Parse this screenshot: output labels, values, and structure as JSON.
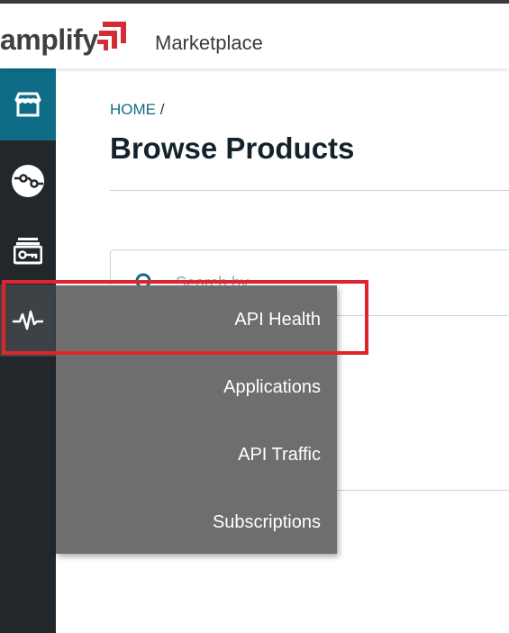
{
  "header": {
    "logo_text": "amplify",
    "app_title": "Marketplace",
    "brand_color": "#d42c36"
  },
  "sidebar": {
    "items": [
      {
        "icon": "storefront-icon",
        "state": "active"
      },
      {
        "icon": "api-connection-icon",
        "state": "default"
      },
      {
        "icon": "credentials-key-icon",
        "state": "default"
      },
      {
        "icon": "pulse-heartbeat-icon",
        "state": "hover"
      }
    ],
    "active_color": "#0e6c86"
  },
  "main": {
    "breadcrumb": {
      "home": "HOME",
      "separator": "/"
    },
    "title": "Browse Products",
    "search": {
      "placeholder": "Search by..."
    }
  },
  "flyout_menu": {
    "items": [
      {
        "label": "API Health"
      },
      {
        "label": "Applications"
      },
      {
        "label": "API Traffic"
      },
      {
        "label": "Subscriptions"
      }
    ]
  },
  "annotation": {
    "highlight_color": "#e0242f",
    "highlighted_item": "API Health"
  }
}
